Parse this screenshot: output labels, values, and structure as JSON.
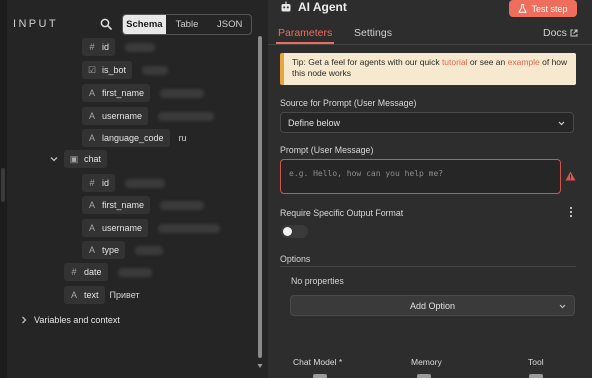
{
  "input_panel": {
    "title": "INPUT",
    "view_tabs": [
      "Schema",
      "Table",
      "JSON"
    ],
    "active_view": "Schema",
    "fields": [
      {
        "type_icon": "#",
        "name": "id",
        "value": ""
      },
      {
        "type_icon": "☑",
        "name": "is_bot",
        "value": ""
      },
      {
        "type_icon": "A",
        "name": "first_name",
        "value": ""
      },
      {
        "type_icon": "A",
        "name": "username",
        "value": ""
      },
      {
        "type_icon": "A",
        "name": "language_code",
        "value": "ru"
      },
      {
        "type_icon": "▣",
        "name": "chat",
        "value": ""
      },
      {
        "type_icon": "#",
        "name": "id",
        "value": ""
      },
      {
        "type_icon": "A",
        "name": "first_name",
        "value": ""
      },
      {
        "type_icon": "A",
        "name": "username",
        "value": ""
      },
      {
        "type_icon": "A",
        "name": "type",
        "value": ""
      },
      {
        "type_icon": "#",
        "name": "date",
        "value": ""
      },
      {
        "type_icon": "A",
        "name": "text",
        "value": "Привет"
      }
    ],
    "variables_label": "Variables and context"
  },
  "node_panel": {
    "title": "AI Agent",
    "test_step_label": "Test step",
    "accent_color": "#ee6d5c",
    "tabs": {
      "parameters": "Parameters",
      "settings": "Settings",
      "docs": "Docs"
    },
    "tip": {
      "prefix": "Tip: Get a feel for agents with our quick ",
      "link1": "tutorial",
      "middle": " or see an ",
      "link2": "example",
      "suffix": " of how this node works"
    },
    "source_label": "Source for Prompt (User Message)",
    "source_value": "Define below",
    "prompt_label": "Prompt (User Message)",
    "prompt_placeholder": "e.g. Hello, how can you help me?",
    "output_format_label": "Require Specific Output Format",
    "output_format_enabled": false,
    "options_label": "Options",
    "no_properties": "No properties",
    "add_option_label": "Add Option",
    "sub_nodes": [
      "Chat Model *",
      "Memory",
      "Tool"
    ]
  }
}
